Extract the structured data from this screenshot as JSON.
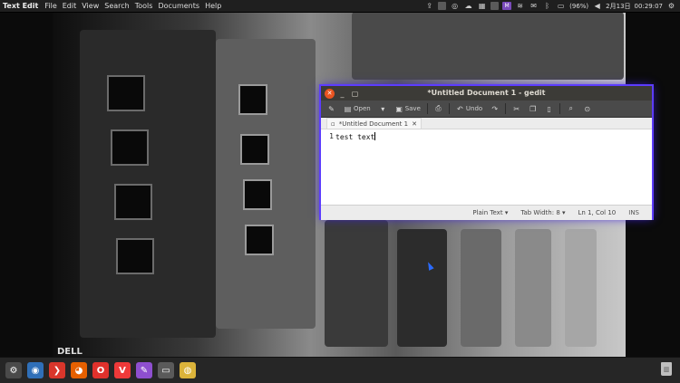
{
  "top_panel": {
    "app_name": "Text Edit",
    "menus": [
      "File",
      "Edit",
      "View",
      "Search",
      "Tools",
      "Documents",
      "Help"
    ],
    "tray": {
      "battery": "(96%)",
      "date": "2月13日",
      "time": "00:29:07"
    }
  },
  "window": {
    "title": "*Untitled Document 1 - gedit",
    "toolbar": {
      "open_label": "Open",
      "save_label": "Save",
      "undo_label": "Undo"
    },
    "tab_label": "*Untitled Document 1",
    "editor": {
      "line_number": "1",
      "content": "test text"
    },
    "statusbar": {
      "language": "Plain Text",
      "tab_width": "Tab Width: 8",
      "position": "Ln 1, Col 10",
      "mode": "INS"
    }
  },
  "desktop": {
    "wallpaper_text": "DELL"
  },
  "dock": {
    "items": [
      {
        "icon": "system-settings-icon",
        "color": "#4a4a4a"
      },
      {
        "icon": "browser-blue-icon",
        "color": "#2f6fb8"
      },
      {
        "icon": "arrow-red-icon",
        "color": "#d9362b"
      },
      {
        "icon": "firefox-icon",
        "color": "#e66000"
      },
      {
        "icon": "opera-icon",
        "color": "#e0312c"
      },
      {
        "icon": "vivaldi-icon",
        "color": "#ef3939"
      },
      {
        "icon": "text-editor-icon",
        "color": "#8e4fcf"
      },
      {
        "icon": "screen-icon",
        "color": "#5a5a5a"
      },
      {
        "icon": "chrome-icon",
        "color": "#dbb33a"
      }
    ]
  },
  "colors": {
    "window_accent": "#5c3cff",
    "close_button": "#e95420"
  }
}
